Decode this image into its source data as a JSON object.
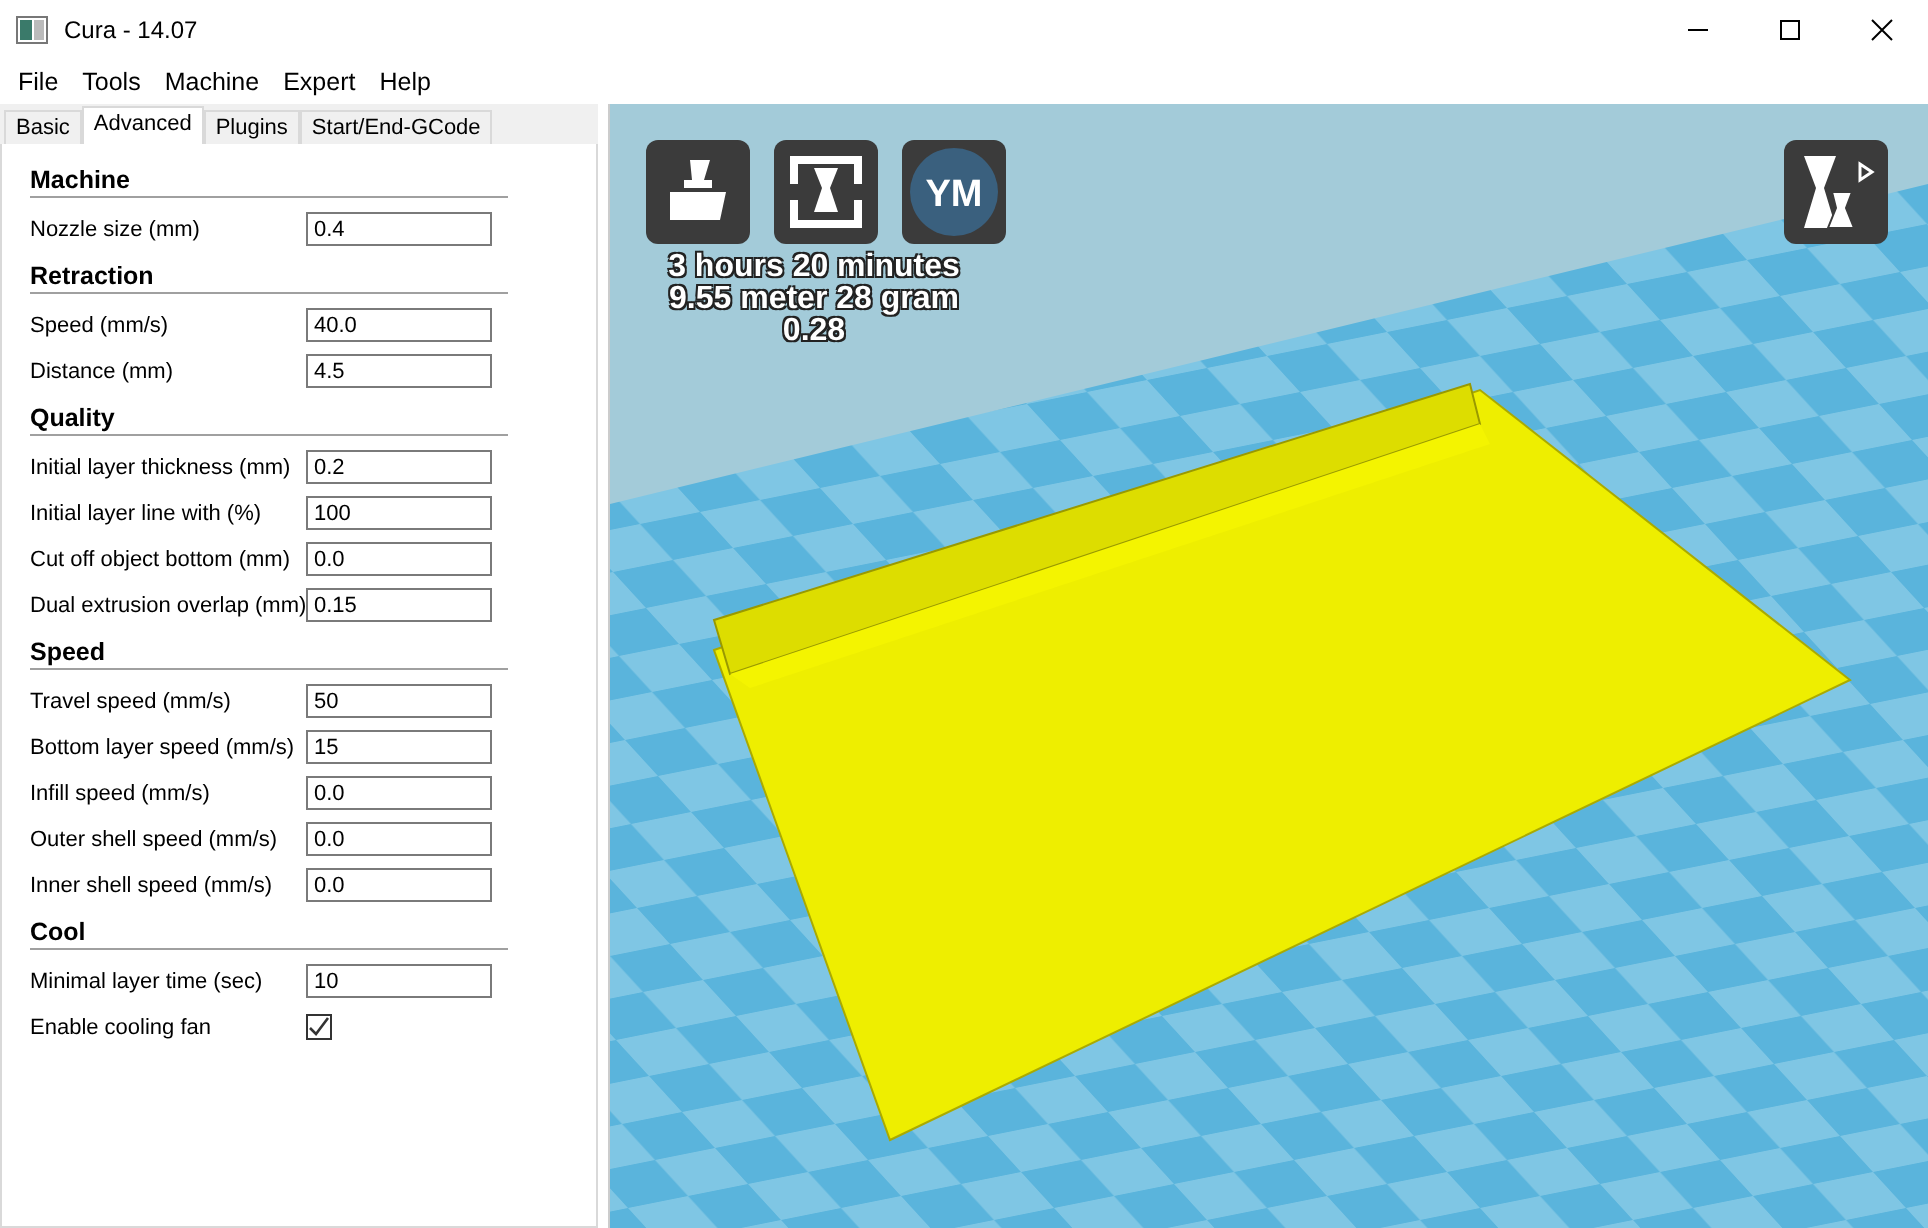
{
  "window": {
    "title": "Cura - 14.07"
  },
  "menu": [
    "File",
    "Tools",
    "Machine",
    "Expert",
    "Help"
  ],
  "tabs": [
    {
      "label": "Basic",
      "selected": false
    },
    {
      "label": "Advanced",
      "selected": true
    },
    {
      "label": "Plugins",
      "selected": false
    },
    {
      "label": "Start/End-GCode",
      "selected": false
    }
  ],
  "sections": [
    {
      "title": "Machine",
      "fields": [
        {
          "kind": "text",
          "label": "Nozzle size (mm)",
          "value": "0.4"
        }
      ]
    },
    {
      "title": "Retraction",
      "fields": [
        {
          "kind": "text",
          "label": "Speed (mm/s)",
          "value": "40.0"
        },
        {
          "kind": "text",
          "label": "Distance (mm)",
          "value": "4.5"
        }
      ]
    },
    {
      "title": "Quality",
      "fields": [
        {
          "kind": "text",
          "label": "Initial layer thickness (mm)",
          "value": "0.2"
        },
        {
          "kind": "text",
          "label": "Initial layer line with (%)",
          "value": "100"
        },
        {
          "kind": "text",
          "label": "Cut off object bottom (mm)",
          "value": "0.0"
        },
        {
          "kind": "text",
          "label": "Dual extrusion overlap (mm)",
          "value": "0.15"
        }
      ]
    },
    {
      "title": "Speed",
      "fields": [
        {
          "kind": "text",
          "label": "Travel speed (mm/s)",
          "value": "50"
        },
        {
          "kind": "text",
          "label": "Bottom layer speed (mm/s)",
          "value": "15"
        },
        {
          "kind": "text",
          "label": "Infill speed (mm/s)",
          "value": "0.0"
        },
        {
          "kind": "text",
          "label": "Outer shell speed (mm/s)",
          "value": "0.0"
        },
        {
          "kind": "text",
          "label": "Inner shell speed (mm/s)",
          "value": "0.0"
        }
      ]
    },
    {
      "title": "Cool",
      "fields": [
        {
          "kind": "text",
          "label": "Minimal layer time (sec)",
          "value": "10"
        },
        {
          "kind": "checkbox",
          "label": "Enable cooling fan",
          "checked": true
        }
      ]
    }
  ],
  "viewport": {
    "toolbar_badge": "YM",
    "print_info": [
      "3 hours 20 minutes",
      "9.55 meter 28 gram",
      "0.28"
    ]
  }
}
